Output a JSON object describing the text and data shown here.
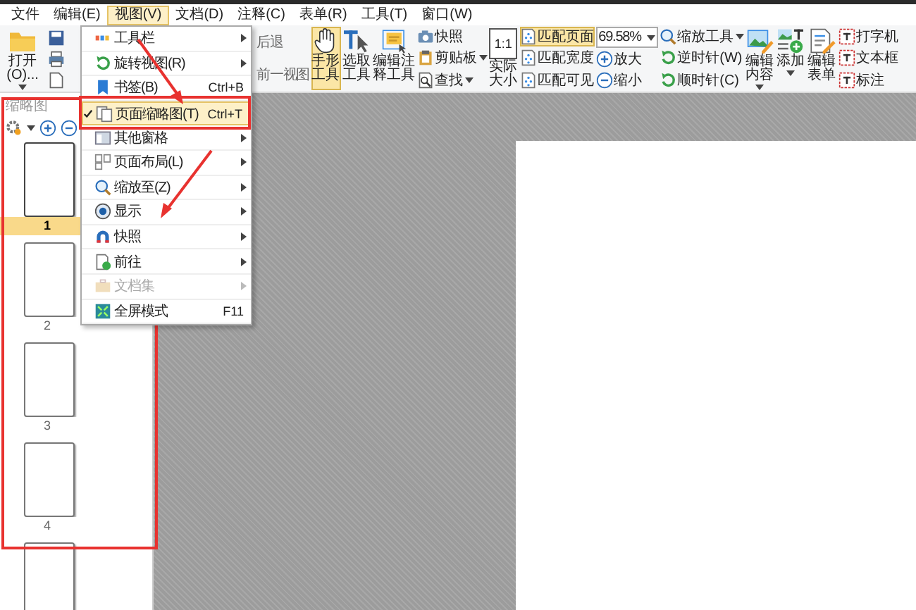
{
  "menubar": [
    {
      "label": "文件",
      "selected": false
    },
    {
      "label": "编辑(E)",
      "selected": false
    },
    {
      "label": "视图(V)",
      "selected": true
    },
    {
      "label": "文档(D)",
      "selected": false
    },
    {
      "label": "注释(C)",
      "selected": false
    },
    {
      "label": "表单(R)",
      "selected": false
    },
    {
      "label": "工具(T)",
      "selected": false
    },
    {
      "label": "窗口(W)",
      "selected": false
    }
  ],
  "ribbon": [
    {
      "kind": "large",
      "label": "打开(O)...",
      "dropdown": true,
      "selected": false
    },
    {
      "kind": "quick"
    },
    {
      "kind": "stack",
      "items": [
        {
          "kind": "text",
          "label": "后退",
          "selected": false,
          "dropdown": false
        },
        {
          "kind": "text",
          "label": "前一视图",
          "selected": false,
          "dropdown": false
        }
      ]
    },
    {
      "kind": "large",
      "label": "手形工具",
      "dropdown": false,
      "selected": true
    },
    {
      "kind": "large",
      "label": "选取工具",
      "dropdown": false,
      "selected": false
    },
    {
      "kind": "large",
      "label": "编辑注释工具",
      "dropdown": false,
      "selected": false
    },
    {
      "kind": "stack",
      "items": [
        {
          "kind": "button",
          "label": "快照",
          "selected": false,
          "dropdown": false
        },
        {
          "kind": "button",
          "label": "剪贴板",
          "selected": false,
          "dropdown": true
        },
        {
          "kind": "button",
          "label": "查找",
          "selected": false,
          "dropdown": true
        }
      ]
    },
    {
      "kind": "large",
      "label": "实际大小",
      "icon_text": "1:1",
      "dropdown": false,
      "selected": false
    },
    {
      "kind": "stack",
      "items": [
        {
          "kind": "button",
          "label": "匹配页面",
          "selected": true,
          "dropdown": false
        },
        {
          "kind": "button",
          "label": "匹配宽度",
          "selected": false,
          "dropdown": false
        },
        {
          "kind": "button",
          "label": "匹配可见",
          "selected": false,
          "dropdown": false
        }
      ]
    },
    {
      "kind": "stack",
      "items": [
        {
          "kind": "field",
          "value": "69.58%"
        },
        {
          "kind": "button",
          "label": "放大",
          "selected": false,
          "dropdown": false
        },
        {
          "kind": "button",
          "label": "缩小",
          "selected": false,
          "dropdown": false
        }
      ]
    },
    {
      "kind": "stack",
      "items": [
        {
          "kind": "button",
          "label": "缩放工具",
          "selected": false,
          "dropdown": true
        },
        {
          "kind": "button",
          "label": "逆时针(W)",
          "selected": false,
          "dropdown": false
        },
        {
          "kind": "button",
          "label": "顺时针(C)",
          "selected": false,
          "dropdown": false
        }
      ]
    },
    {
      "kind": "large",
      "label": "编辑内容",
      "dropdown": true,
      "selected": false
    },
    {
      "kind": "large",
      "label": "添加",
      "dropdown": true,
      "selected": false
    },
    {
      "kind": "large",
      "label": "编辑表单",
      "dropdown": false,
      "selected": false
    },
    {
      "kind": "stack",
      "items": [
        {
          "kind": "button",
          "label": "打字机",
          "selected": false,
          "dropdown": false
        },
        {
          "kind": "button",
          "label": "文本框",
          "selected": false,
          "dropdown": false
        },
        {
          "kind": "button",
          "label": "标注",
          "selected": false,
          "dropdown": false
        }
      ]
    }
  ],
  "view_menu": [
    {
      "label": "工具栏",
      "submenu": true,
      "checked": false,
      "selected": false,
      "disabled": false
    },
    {
      "label": "旋转视图(R)",
      "submenu": true,
      "checked": false,
      "selected": false,
      "disabled": false
    },
    {
      "label": "书签(B)",
      "shortcut": "Ctrl+B",
      "submenu": false,
      "checked": false,
      "selected": false,
      "disabled": false
    },
    {
      "label": "页面缩略图(T)",
      "shortcut": "Ctrl+T",
      "submenu": false,
      "checked": true,
      "selected": true,
      "disabled": false
    },
    {
      "label": "其他窗格",
      "submenu": true,
      "checked": false,
      "selected": false,
      "disabled": false
    },
    {
      "label": "页面布局(L)",
      "submenu": true,
      "checked": false,
      "selected": false,
      "disabled": false
    },
    {
      "label": "缩放至(Z)",
      "submenu": true,
      "checked": false,
      "selected": false,
      "disabled": false
    },
    {
      "label": "显示",
      "submenu": true,
      "checked": false,
      "selected": false,
      "disabled": false
    },
    {
      "label": "快照",
      "submenu": true,
      "checked": false,
      "selected": false,
      "disabled": false
    },
    {
      "label": "前往",
      "submenu": true,
      "checked": false,
      "selected": false,
      "disabled": false
    },
    {
      "label": "文档集",
      "submenu": true,
      "checked": false,
      "selected": false,
      "disabled": true
    },
    {
      "label": "全屏模式",
      "shortcut": "F11",
      "submenu": false,
      "checked": false,
      "selected": false,
      "disabled": false
    }
  ],
  "thumbnails": {
    "title": "缩略图",
    "pages": [
      {
        "label": "1",
        "selected": true
      },
      {
        "label": "2",
        "selected": false
      },
      {
        "label": "3",
        "selected": false
      },
      {
        "label": "4",
        "selected": false
      },
      {
        "selected": false
      }
    ]
  }
}
